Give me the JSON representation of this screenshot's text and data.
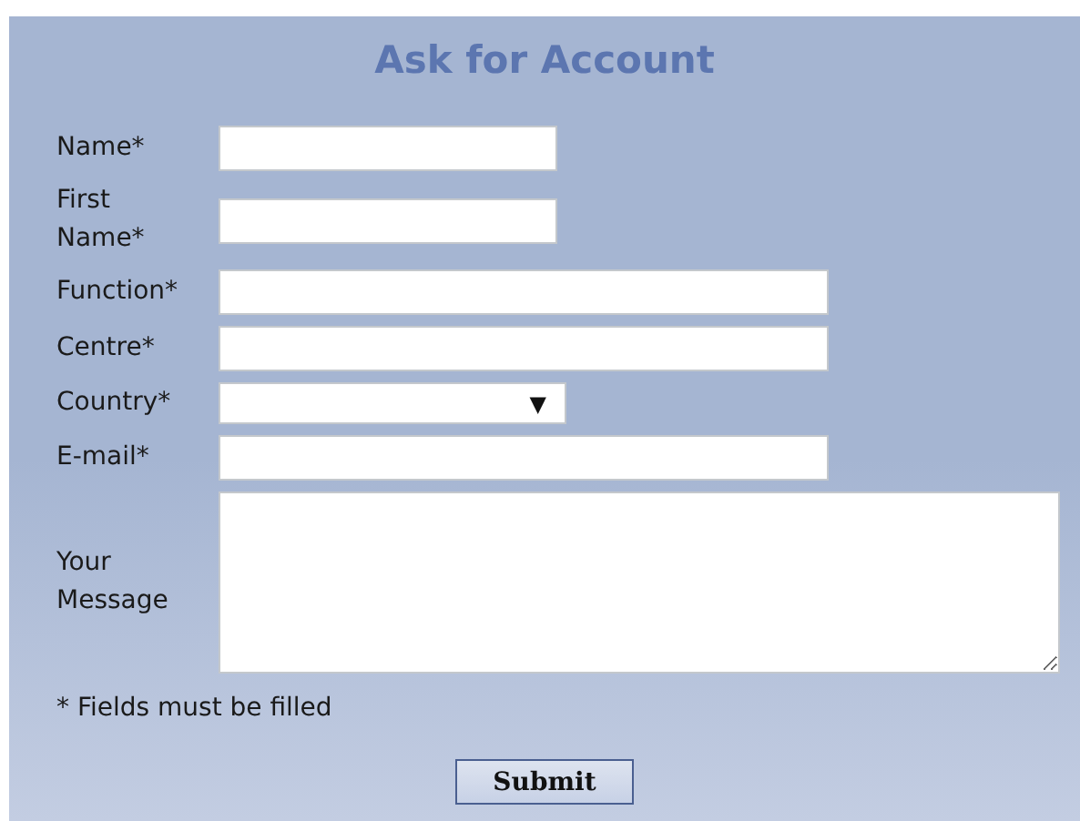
{
  "form": {
    "title": "Ask for Account",
    "fields": [
      {
        "label": "Name*",
        "kind": "short"
      },
      {
        "label": "First Name*",
        "kind": "short"
      },
      {
        "label": "Function*",
        "kind": "long"
      },
      {
        "label": "Centre*",
        "kind": "long"
      },
      {
        "label": "Country*",
        "kind": "select",
        "caret": "▼"
      },
      {
        "label": "E-mail*",
        "kind": "long"
      },
      {
        "label": "Your Message",
        "kind": "textarea"
      }
    ],
    "note": "* Fields must be filled",
    "submit": "Submit"
  }
}
